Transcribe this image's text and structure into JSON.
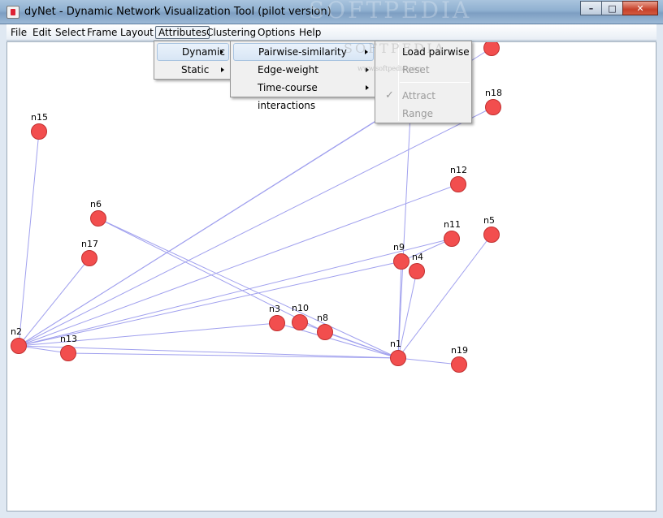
{
  "window": {
    "title": "dyNet - Dynamic Network Visualization Tool (pilot version)"
  },
  "watermark": {
    "text": "SOFTPEDIA",
    "small": "SOFTPEDIA",
    "url": "www.softpedia.com"
  },
  "menubar": {
    "file": "File",
    "edit": "Edit",
    "select": "Select",
    "frame": "Frame",
    "layout": "Layout",
    "attributes": "Attributes",
    "clustering": "Clustering",
    "options": "Options",
    "help": "Help"
  },
  "attributes_menu": {
    "dynamic": "Dynamic",
    "static": "Static"
  },
  "dynamic_menu": {
    "pairwise": "Pairwise-similarity",
    "edge_weight": "Edge-weight",
    "time_course": "Time-course interactions"
  },
  "pairwise_menu": {
    "load": "Load pairwise",
    "reset": "Reset",
    "attract": "Attract",
    "range": "Range"
  },
  "graph": {
    "node_color": "#f24e4e",
    "edge_color": "#a0a0ee",
    "nodes": [
      {
        "id": "n15",
        "label": "n15"
      },
      {
        "id": "n6",
        "label": "n6"
      },
      {
        "id": "n17",
        "label": "n17"
      },
      {
        "id": "n2",
        "label": "n2"
      },
      {
        "id": "n13",
        "label": "n13"
      },
      {
        "id": "n3",
        "label": "n3"
      },
      {
        "id": "n10",
        "label": "n10"
      },
      {
        "id": "n8",
        "label": "n8"
      },
      {
        "id": "n1",
        "label": "n1"
      },
      {
        "id": "n19",
        "label": "n19"
      },
      {
        "id": "n9",
        "label": "n9"
      },
      {
        "id": "n4",
        "label": "n4"
      },
      {
        "id": "n11",
        "label": "n11"
      },
      {
        "id": "n5",
        "label": "n5"
      },
      {
        "id": "n12",
        "label": "n12"
      },
      {
        "id": "n18",
        "label": "n18"
      }
    ]
  }
}
